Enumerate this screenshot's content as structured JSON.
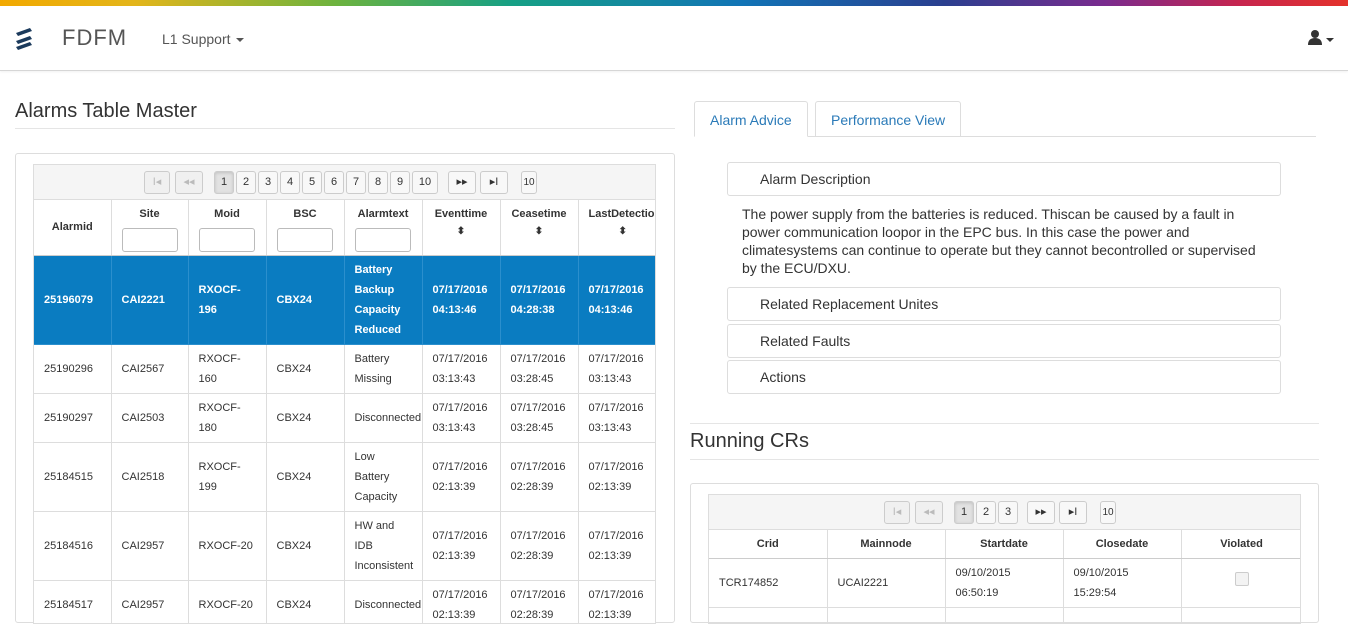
{
  "app": {
    "name": "FDFM",
    "menu_label": "L1 Support"
  },
  "alarms": {
    "title": "Alarms Table Master",
    "pager": {
      "first": "I◂",
      "prev": "◂◂",
      "pages": [
        "1",
        "2",
        "3",
        "4",
        "5",
        "6",
        "7",
        "8",
        "9",
        "10"
      ],
      "active": "1",
      "next": "▸▸",
      "last": "▸I",
      "page_size": "10"
    },
    "columns": [
      "Alarmid",
      "Site",
      "Moid",
      "BSC",
      "Alarmtext",
      "Eventtime",
      "Ceasetime",
      "LastDetection"
    ],
    "rows": [
      {
        "alarmid": "25196079",
        "site": "CAI2221",
        "moid": [
          "RXOCF-",
          "196"
        ],
        "bsc": "CBX24",
        "text": [
          "Battery",
          "Backup",
          "Capacity",
          "Reduced"
        ],
        "event": [
          "07/17/2016",
          "04:13:46"
        ],
        "cease": [
          "07/17/2016",
          "04:28:38"
        ],
        "last": [
          "07/17/2016",
          "04:13:46"
        ]
      },
      {
        "alarmid": "25190296",
        "site": "CAI2567",
        "moid": [
          "RXOCF-",
          "160"
        ],
        "bsc": "CBX24",
        "text": [
          "Battery",
          "Missing"
        ],
        "event": [
          "07/17/2016",
          "03:13:43"
        ],
        "cease": [
          "07/17/2016",
          "03:28:45"
        ],
        "last": [
          "07/17/2016",
          "03:13:43"
        ]
      },
      {
        "alarmid": "25190297",
        "site": "CAI2503",
        "moid": [
          "RXOCF-",
          "180"
        ],
        "bsc": "CBX24",
        "text": [
          "Disconnected"
        ],
        "event": [
          "07/17/2016",
          "03:13:43"
        ],
        "cease": [
          "07/17/2016",
          "03:28:45"
        ],
        "last": [
          "07/17/2016",
          "03:13:43"
        ]
      },
      {
        "alarmid": "25184515",
        "site": "CAI2518",
        "moid": [
          "RXOCF-",
          "199"
        ],
        "bsc": "CBX24",
        "text": [
          "Low",
          "Battery",
          "Capacity"
        ],
        "event": [
          "07/17/2016",
          "02:13:39"
        ],
        "cease": [
          "07/17/2016",
          "02:28:39"
        ],
        "last": [
          "07/17/2016",
          "02:13:39"
        ]
      },
      {
        "alarmid": "25184516",
        "site": "CAI2957",
        "moid": [
          "RXOCF-20"
        ],
        "bsc": "CBX24",
        "text": [
          "HW and",
          "IDB",
          "Inconsistent"
        ],
        "event": [
          "07/17/2016",
          "02:13:39"
        ],
        "cease": [
          "07/17/2016",
          "02:28:39"
        ],
        "last": [
          "07/17/2016",
          "02:13:39"
        ]
      },
      {
        "alarmid": "25184517",
        "site": "CAI2957",
        "moid": [
          "RXOCF-20"
        ],
        "bsc": "CBX24",
        "text": [
          "Disconnected"
        ],
        "event": [
          "07/17/2016",
          "02:13:39"
        ],
        "cease": [
          "07/17/2016",
          "02:28:39"
        ],
        "last": [
          "07/17/2016",
          "02:13:39"
        ]
      }
    ]
  },
  "advice": {
    "tabs": [
      "Alarm Advice",
      "Performance View"
    ],
    "sections": [
      "Alarm Description",
      "Related Replacement Unites",
      "Related Faults",
      "Actions"
    ],
    "description": "The power supply from the batteries is reduced. Thiscan be caused by a fault in power communication loopor in the EPC bus. In this case the power and climatesystems can continue to operate but they cannot becontrolled or supervised by the ECU/DXU."
  },
  "crs": {
    "title": "Running CRs",
    "pager": {
      "pages": [
        "1",
        "2",
        "3"
      ],
      "active": "1",
      "page_size": "10"
    },
    "columns": [
      "Crid",
      "Mainnode",
      "Startdate",
      "Closedate",
      "Violated"
    ],
    "rows": [
      {
        "crid": "TCR174852",
        "mainnode": "UCAI2221",
        "start": [
          "09/10/2015",
          "06:50:19"
        ],
        "close": [
          "09/10/2015",
          "15:29:54"
        ]
      }
    ]
  },
  "colors": {
    "accent": "#0a7cc1",
    "link": "#2a7ab8"
  }
}
